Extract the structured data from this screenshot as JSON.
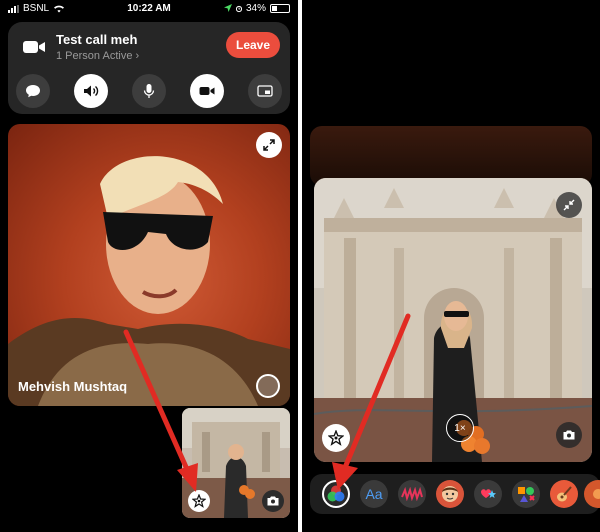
{
  "status_bar": {
    "carrier": "BSNL",
    "time": "10:22 AM",
    "battery": "34%"
  },
  "call": {
    "title": "Test call meh",
    "subtitle": "1 Person Active",
    "leave_label": "Leave",
    "controls": [
      "message-icon",
      "speaker-icon",
      "microphone-icon",
      "camera-icon",
      "share-screen-icon"
    ]
  },
  "main_video": {
    "participant_name": "Mehvish Mushtaq"
  },
  "effects_panel": {
    "zoom_label": "1×",
    "text_effect_label": "Aa",
    "effects": [
      "filters-icon",
      "text-icon",
      "shapes-icon",
      "memoji-icon",
      "stickers-icon",
      "shapes-sticker-icon",
      "guitar-sticker-icon",
      "more-sticker-icon"
    ]
  },
  "colors": {
    "leave": "#eb4d3d",
    "annotation_arrow": "#e12b23",
    "background": "#000000",
    "card": "#262626"
  }
}
